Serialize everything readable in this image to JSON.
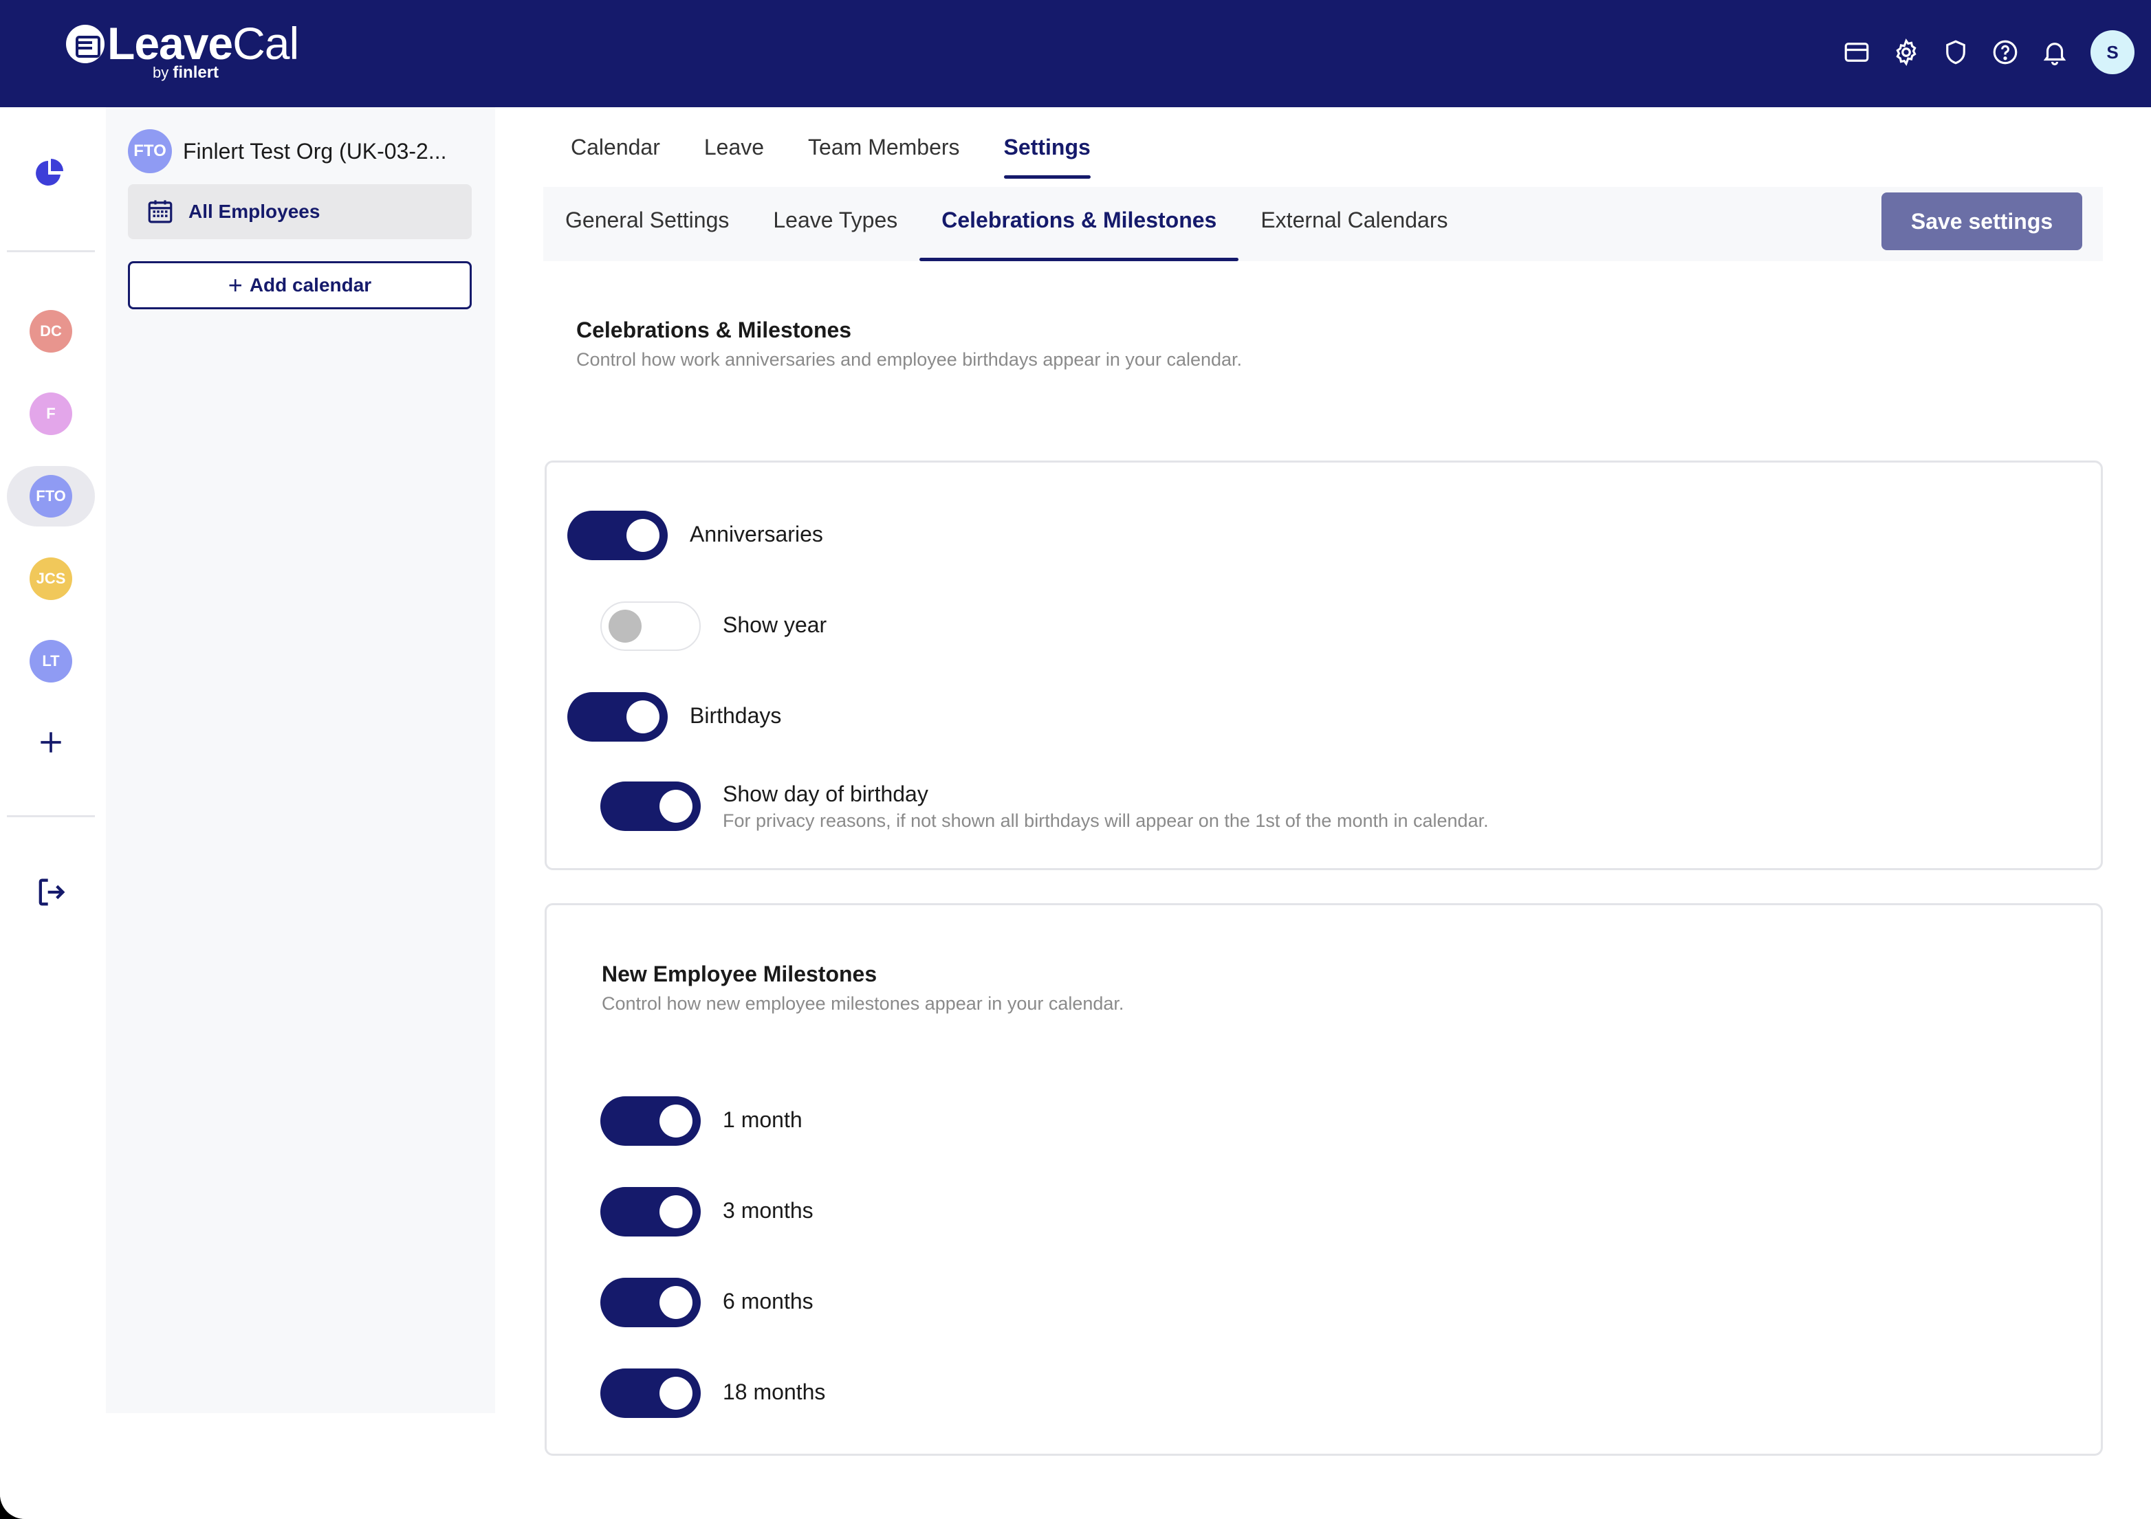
{
  "header": {
    "logo_bold": "Leave",
    "logo_light": "Cal",
    "logo_by": "by",
    "logo_company": "finlert",
    "icons": [
      "billing-card-icon",
      "gear-icon",
      "shield-icon",
      "help-icon",
      "bell-icon"
    ],
    "user_initial": "S"
  },
  "rail": {
    "calendars": [
      {
        "initials": "DC",
        "color": "#e8958e"
      },
      {
        "initials": "F",
        "color": "#e3a6ea"
      },
      {
        "initials": "FTO",
        "color": "#8f9bf3",
        "active": true
      },
      {
        "initials": "JCS",
        "color": "#f1c85a"
      },
      {
        "initials": "LT",
        "color": "#8f9bf3"
      }
    ]
  },
  "sidebar": {
    "org_initials": "FTO",
    "org_name": "Finlert Test Org (UK-03-2...",
    "all_employees": "All Employees",
    "add_calendar": "Add calendar"
  },
  "main_tabs": [
    {
      "label": "Calendar"
    },
    {
      "label": "Leave"
    },
    {
      "label": "Team Members"
    },
    {
      "label": "Settings",
      "active": true
    }
  ],
  "settings_tabs": [
    {
      "label": "General Settings"
    },
    {
      "label": "Leave Types"
    },
    {
      "label": "Celebrations & Milestones",
      "active": true
    },
    {
      "label": "External Calendars"
    }
  ],
  "save_button": "Save settings",
  "section": {
    "title": "Celebrations & Milestones",
    "description": "Control how work anniversaries and employee birthdays appear in your calendar."
  },
  "celebrations": {
    "anniversaries": {
      "label": "Anniversaries",
      "enabled": true
    },
    "show_year": {
      "label": "Show year",
      "enabled": false
    },
    "birthdays": {
      "label": "Birthdays",
      "enabled": true
    },
    "show_day_of_birthday": {
      "label": "Show day of birthday",
      "hint": "For privacy reasons, if not shown all birthdays will appear on the 1st of the month in calendar.",
      "enabled": true
    }
  },
  "milestones": {
    "title": "New Employee Milestones",
    "description": "Control how new employee milestones appear in your calendar.",
    "items": [
      {
        "label": "1 month",
        "enabled": true
      },
      {
        "label": "3 months",
        "enabled": true
      },
      {
        "label": "6 months",
        "enabled": true
      },
      {
        "label": "18 months",
        "enabled": true
      }
    ]
  }
}
